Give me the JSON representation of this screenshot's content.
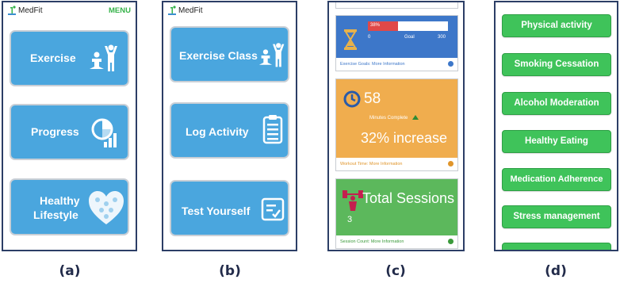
{
  "captions": [
    "(a)",
    "(b)",
    "(c)",
    "(d)"
  ],
  "app": {
    "name": "MedFit",
    "menu_label": "MENU"
  },
  "panel_a": {
    "tiles": [
      "Exercise",
      "Progress",
      "Healthy",
      "Lifestyle"
    ]
  },
  "panel_b": {
    "tiles": [
      "Exercise Class",
      "Log Activity",
      "Test Yourself"
    ]
  },
  "panel_c": {
    "goal": {
      "progress_label": "38%",
      "progress_fraction": 0.38,
      "tick_start": "0",
      "tick_goal": "Goal",
      "tick_end": "300",
      "footer": "Exercise Goals: More Information",
      "color": "#3d77c9"
    },
    "workout": {
      "value": "58",
      "sublabel": "Minutes Complete",
      "increase": "32% increase",
      "footer": "Workout Time: More Information",
      "color": "#f0ad4e"
    },
    "sessions": {
      "title": "Total Sessions",
      "value": "3",
      "footer": "Session Count: More Information",
      "color": "#5cb85c"
    }
  },
  "panel_d": {
    "buttons": [
      "Physical activity",
      "Smoking Cessation",
      "Alcohol Moderation",
      "Healthy Eating",
      "Medication Adherence",
      "Stress management"
    ]
  },
  "colors": {
    "tile_blue": "#4aa6de",
    "menu_green": "#36b34a",
    "button_green": "#3fc35a"
  }
}
